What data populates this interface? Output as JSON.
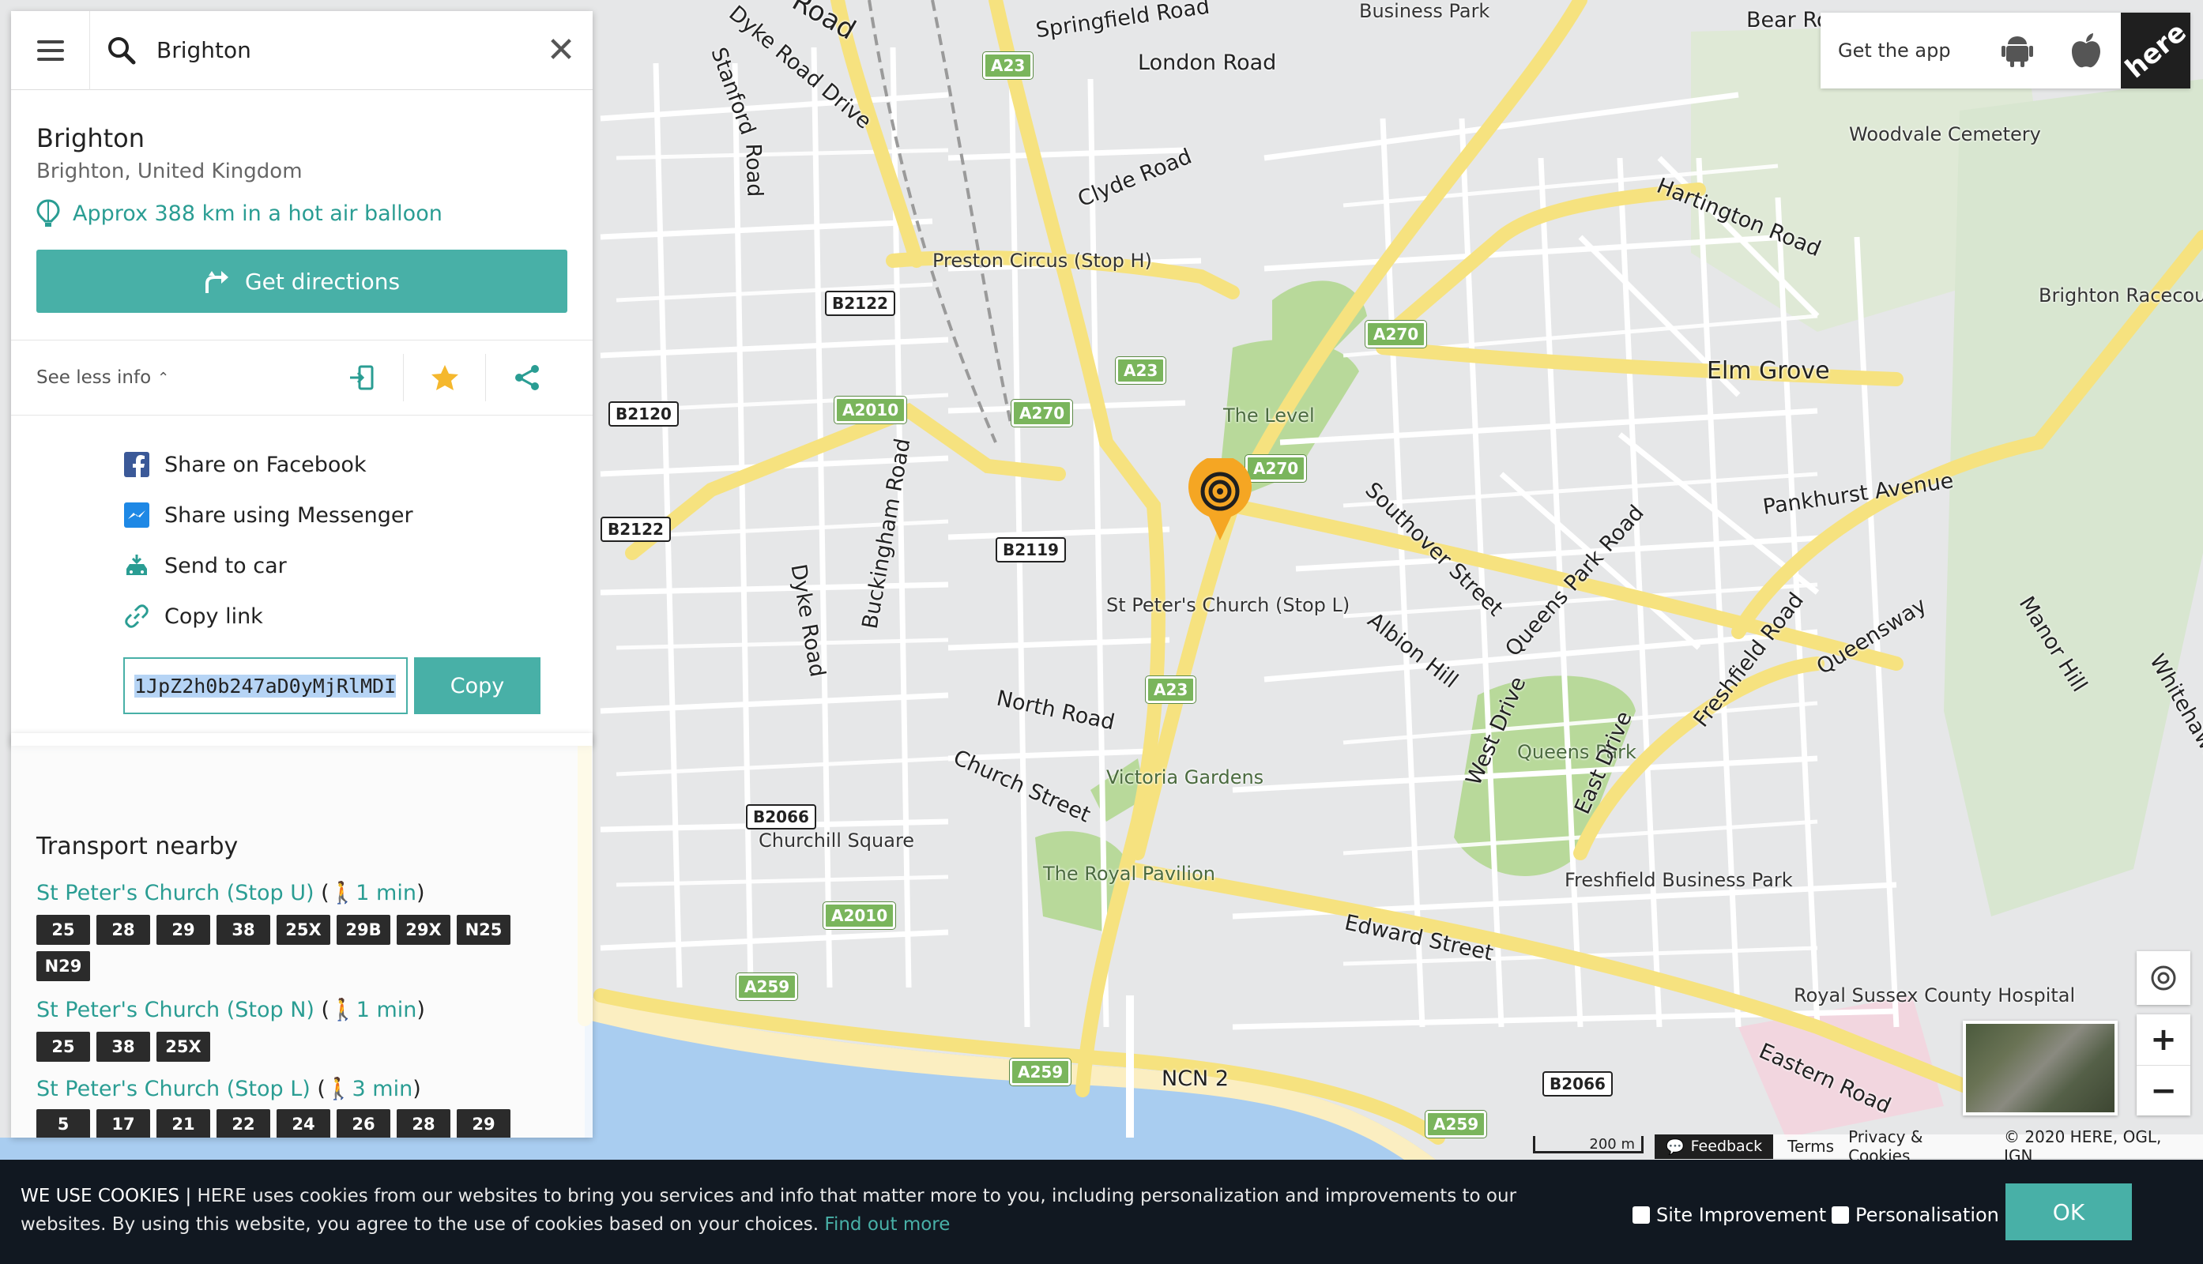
{
  "search": {
    "value": "Brighton"
  },
  "place": {
    "title": "Brighton",
    "subtitle": "Brighton, United Kingdom",
    "distance_text": "Approx 388 km in a hot air balloon",
    "directions_label": "Get directions",
    "see_less_label": "See less info"
  },
  "share": {
    "items": [
      {
        "label": "Share on Facebook",
        "icon": "facebook-icon"
      },
      {
        "label": "Share using Messenger",
        "icon": "messenger-icon"
      },
      {
        "label": "Send to car",
        "icon": "car-icon"
      },
      {
        "label": "Copy link",
        "icon": "link-icon"
      }
    ],
    "link_value": "1JpZ2h0b247aD0yMjRlMDI",
    "copy_label": "Copy"
  },
  "transport": {
    "title": "Transport nearby",
    "stops": [
      {
        "name": "St Peter's Church (Stop U)",
        "time": "1 min",
        "buses": [
          "25",
          "28",
          "29",
          "38",
          "25X",
          "29B",
          "29X",
          "N25",
          "N29"
        ]
      },
      {
        "name": "St Peter's Church (Stop N)",
        "time": "1 min",
        "buses": [
          "25",
          "38",
          "25X"
        ]
      },
      {
        "name": "St Peter's Church (Stop L)",
        "time": "3 min",
        "buses": [
          "5",
          "17",
          "21",
          "22",
          "24",
          "26",
          "28",
          "29"
        ]
      }
    ]
  },
  "appbar": {
    "get_app_label": "Get the app",
    "logo_text": "here"
  },
  "map": {
    "labels": {
      "springfield": "Springfield Road",
      "london": "London Road",
      "dyke_road_drive": "Dyke Road Drive",
      "stanford": "Stanford",
      "road_v": "Road",
      "clyde": "Clyde Road",
      "woodvale": "Woodvale Cemetery",
      "hartington": "Hartington Road",
      "preston": "Preston Circus (Stop H)",
      "brighton_race": "Brighton Racecourse",
      "elm": "Elm Grove",
      "the_level": "The Level",
      "pankhurst": "Pankhurst Avenue",
      "southover": "Southover Street",
      "queens_park_road": "Queens Park Road",
      "albion": "Albion Hill",
      "freshfield_road": "Freshfield Road",
      "queensway": "Queensway",
      "manor_hill": "Manor Hill",
      "whitehawk": "Whitehawk",
      "st_peters": "St Peter's Church (Stop L)",
      "dyke_road": "Dyke Road",
      "buckingham": "Buckingham Road",
      "north_road": "North Road",
      "church_street": "Church Street",
      "victoria": "Victoria Gardens",
      "west_drive": "West Drive",
      "queens_park": "Queens Park",
      "east_drive": "East Drive",
      "churchill": "Churchill Square",
      "royal_pavilion": "The Royal Pavilion",
      "freshfield_bp": "Freshfield Business Park",
      "edward": "Edward Street",
      "royal_sussex": "Royal Sussex County Hospital",
      "eastern": "Eastern Road",
      "ncn": "NCN 2",
      "business_park": "Business Park",
      "bear": "Bear Ro",
      "road_top": "Road"
    },
    "shields": {
      "a23_1": "A23",
      "a23_2": "A23",
      "a23_3": "A23",
      "b2122_1": "B2122",
      "b2122_2": "B2122",
      "b2120": "B2120",
      "a2010_1": "A2010",
      "a2010_2": "A2010",
      "a270_1": "A270",
      "a270_2": "A270",
      "a270_3": "A270",
      "b2119": "B2119",
      "b2066_1": "B2066",
      "b2066_2": "B2066",
      "a259_1": "A259",
      "a259_2": "A259",
      "a259_3": "A259"
    },
    "scale_label": "200 m",
    "feedback_label": "Feedback",
    "terms_label": "Terms",
    "privacy_label": "Privacy & Cookies",
    "copyright": "© 2020 HERE, OGL, IGN"
  },
  "cookie": {
    "heading": "WE USE COOKIES |",
    "text": " HERE uses cookies from our websites to bring you services and info that matter more to you, including personalization and improvements to our websites.  By using this website, you agree to the use of cookies based on your choices.",
    "link": "Find out more",
    "site_improvement": "Site Improvement",
    "personalisation": "Personalisation",
    "ok": "OK"
  },
  "colors": {
    "accent": "#48b0a7",
    "marker": "#f5a623",
    "road_major": "#f6e27f",
    "park": "#b8d99a",
    "sea": "#a9cdf0"
  }
}
